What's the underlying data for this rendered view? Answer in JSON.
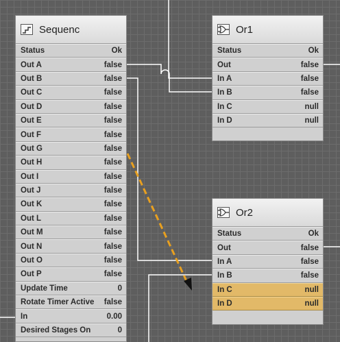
{
  "blocks": {
    "sequencer": {
      "title": "Sequenc",
      "icon": "sequencer-icon",
      "slots": [
        {
          "name": "Status",
          "value": "Ok"
        },
        {
          "name": "Out A",
          "value": "false"
        },
        {
          "name": "Out B",
          "value": "false"
        },
        {
          "name": "Out C",
          "value": "false"
        },
        {
          "name": "Out D",
          "value": "false"
        },
        {
          "name": "Out E",
          "value": "false"
        },
        {
          "name": "Out F",
          "value": "false"
        },
        {
          "name": "Out G",
          "value": "false"
        },
        {
          "name": "Out H",
          "value": "false"
        },
        {
          "name": "Out I",
          "value": "false"
        },
        {
          "name": "Out J",
          "value": "false"
        },
        {
          "name": "Out K",
          "value": "false"
        },
        {
          "name": "Out L",
          "value": "false"
        },
        {
          "name": "Out M",
          "value": "false"
        },
        {
          "name": "Out N",
          "value": "false"
        },
        {
          "name": "Out O",
          "value": "false"
        },
        {
          "name": "Out P",
          "value": "false"
        },
        {
          "name": "Update Time",
          "value": "0"
        },
        {
          "name": "Rotate Timer Active",
          "value": "false"
        },
        {
          "name": "In",
          "value": "0.00"
        },
        {
          "name": "Desired Stages On",
          "value": "0"
        }
      ]
    },
    "or1": {
      "title": "Or1",
      "icon": "or-gate-icon",
      "slots": [
        {
          "name": "Status",
          "value": "Ok"
        },
        {
          "name": "Out",
          "value": "false"
        },
        {
          "name": "In A",
          "value": "false"
        },
        {
          "name": "In B",
          "value": "false"
        },
        {
          "name": "In C",
          "value": "null"
        },
        {
          "name": "In D",
          "value": "null"
        }
      ]
    },
    "or2": {
      "title": "Or2",
      "icon": "or-gate-icon",
      "slots": [
        {
          "name": "Status",
          "value": "Ok"
        },
        {
          "name": "Out",
          "value": "false"
        },
        {
          "name": "In A",
          "value": "false"
        },
        {
          "name": "In B",
          "value": "false"
        },
        {
          "name": "In C",
          "value": "null"
        },
        {
          "name": "In D",
          "value": "null"
        }
      ]
    }
  },
  "colors": {
    "canvas": "#5e5e5e",
    "wire": "#ffffff",
    "drag_link": "#e8a020",
    "highlight_slot": "#e2b968"
  }
}
